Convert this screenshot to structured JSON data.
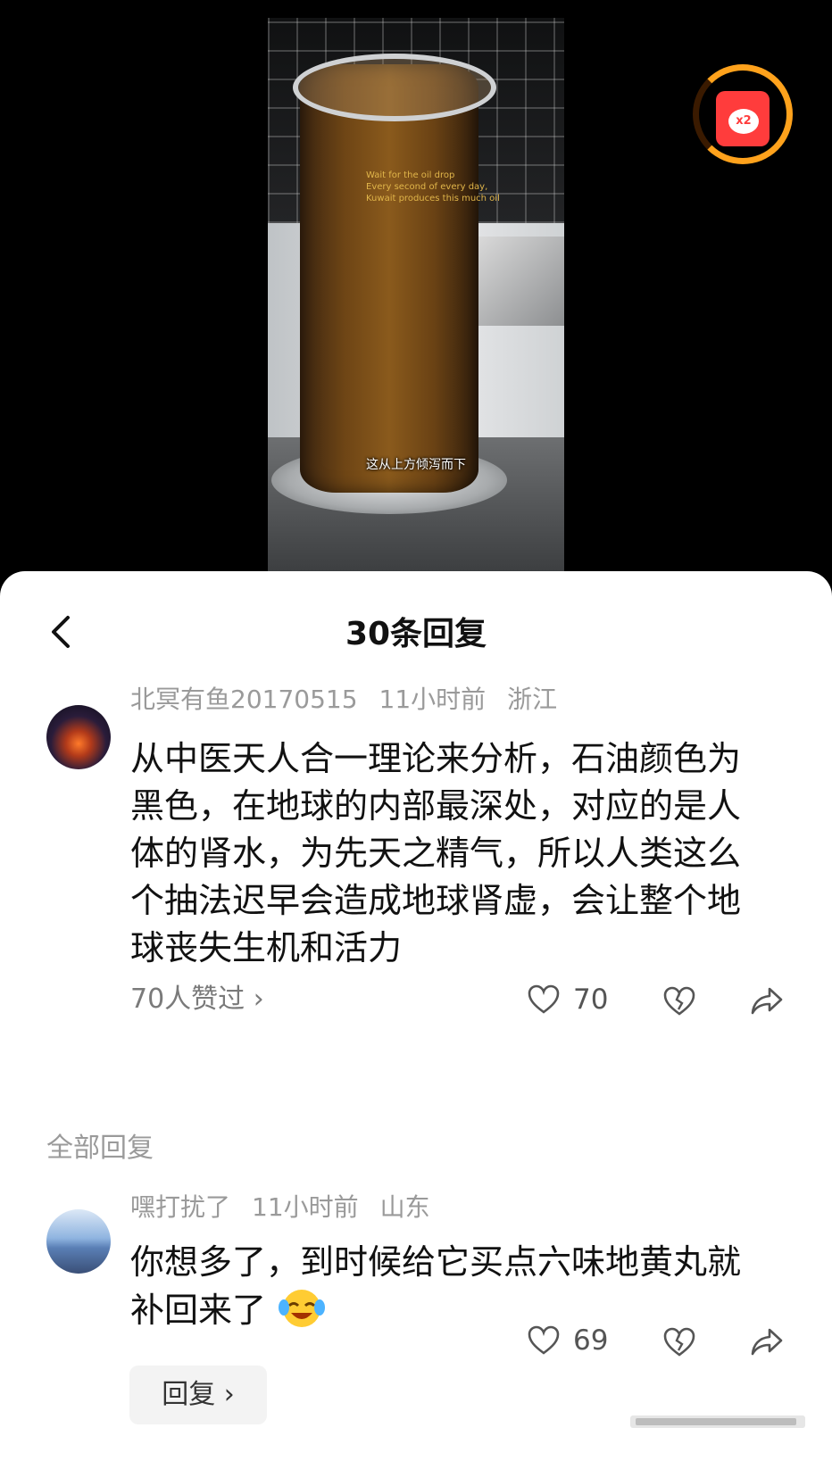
{
  "video": {
    "subtitle": "这从上方倾泻而下",
    "cylinder_text_line1": "Wait for the oil drop",
    "cylinder_text_line2": "Every second of every day,",
    "cylinder_text_line3": "Kuwait produces this much oil"
  },
  "redpacket": {
    "badge": "x2"
  },
  "sheet": {
    "title": "30条回复",
    "main_comment": {
      "user": "北冥有鱼20170515",
      "time": "11小时前",
      "location": "浙江",
      "text": "从中医天人合一理论来分析，石油颜色为黑色，在地球的内部最深处，对应的是人体的肾水，为先天之精气，所以人类这么个抽法迟早会造成地球肾虚，会让整个地球丧失生机和活力",
      "likes_link": "70人赞过 ›",
      "like_count": "70"
    },
    "section_label": "全部回复",
    "reply": {
      "user": "嘿打扰了",
      "time": "11小时前",
      "location": "山东",
      "text": "你想多了，到时候给它买点六味地黄丸就补回来了",
      "reply_button": "回复 ›",
      "like_count": "69"
    }
  }
}
